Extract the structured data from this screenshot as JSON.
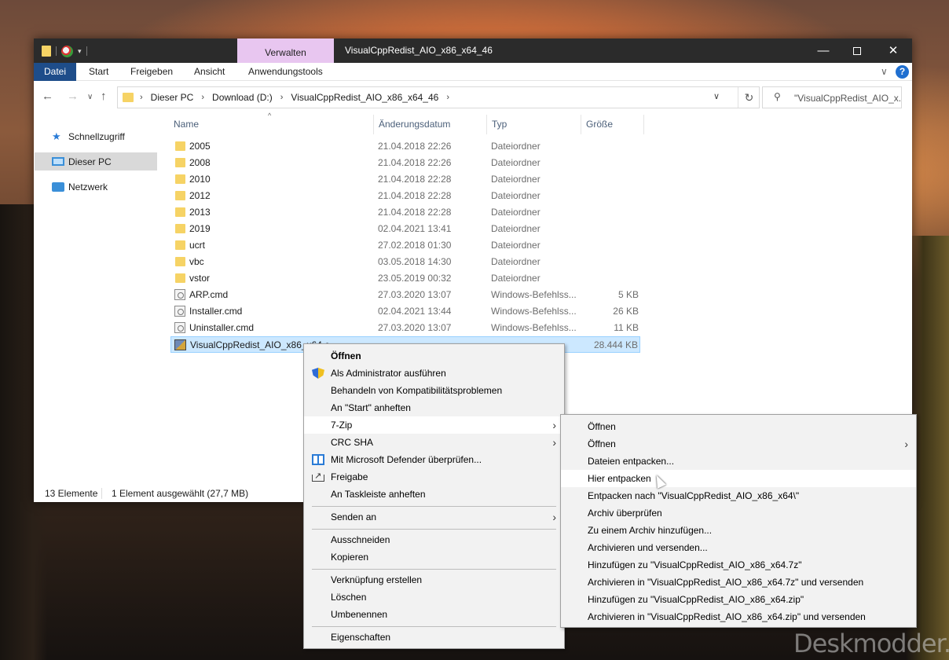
{
  "window": {
    "title": "VisualCppRedist_AIO_x86_x64_46",
    "context_tab": "Verwalten",
    "controls": {
      "minimize": "—",
      "close": "✕"
    }
  },
  "ribbon": {
    "tabs": [
      "Datei",
      "Start",
      "Freigeben",
      "Ansicht",
      "Anwendungstools"
    ],
    "expand": "∨",
    "help": "?"
  },
  "nav": {
    "back": "←",
    "forward": "→",
    "recent": "∨",
    "up": "↑",
    "crumbs": [
      "Dieser PC",
      "Download (D:)",
      "VisualCppRedist_AIO_x86_x64_46"
    ],
    "crumb_sep": "›",
    "refresh": "↻",
    "search_placeholder": "\"VisualCppRedist_AIO_x..."
  },
  "sidebar": {
    "items": [
      "Schnellzugriff",
      "Dieser PC",
      "Netzwerk"
    ]
  },
  "columns": {
    "name": "Name",
    "date": "Änderungsdatum",
    "type": "Typ",
    "size": "Größe"
  },
  "files": [
    {
      "name": "2005",
      "date": "21.04.2018 22:26",
      "type": "Dateiordner",
      "size": "",
      "icon": "folder-icon"
    },
    {
      "name": "2008",
      "date": "21.04.2018 22:26",
      "type": "Dateiordner",
      "size": "",
      "icon": "folder-icon"
    },
    {
      "name": "2010",
      "date": "21.04.2018 22:28",
      "type": "Dateiordner",
      "size": "",
      "icon": "folder-icon"
    },
    {
      "name": "2012",
      "date": "21.04.2018 22:28",
      "type": "Dateiordner",
      "size": "",
      "icon": "folder-icon"
    },
    {
      "name": "2013",
      "date": "21.04.2018 22:28",
      "type": "Dateiordner",
      "size": "",
      "icon": "folder-icon"
    },
    {
      "name": "2019",
      "date": "02.04.2021 13:41",
      "type": "Dateiordner",
      "size": "",
      "icon": "folder-icon"
    },
    {
      "name": "ucrt",
      "date": "27.02.2018 01:30",
      "type": "Dateiordner",
      "size": "",
      "icon": "folder-icon"
    },
    {
      "name": "vbc",
      "date": "03.05.2018 14:30",
      "type": "Dateiordner",
      "size": "",
      "icon": "folder-icon"
    },
    {
      "name": "vstor",
      "date": "23.05.2019 00:32",
      "type": "Dateiordner",
      "size": "",
      "icon": "folder-icon"
    },
    {
      "name": "ARP.cmd",
      "date": "27.03.2020 13:07",
      "type": "Windows-Befehlss...",
      "size": "5 KB",
      "icon": "cmd-file-icon"
    },
    {
      "name": "Installer.cmd",
      "date": "02.04.2021 13:44",
      "type": "Windows-Befehlss...",
      "size": "26 KB",
      "icon": "cmd-file-icon"
    },
    {
      "name": "Uninstaller.cmd",
      "date": "27.03.2020 13:07",
      "type": "Windows-Befehlss...",
      "size": "11 KB",
      "icon": "cmd-file-icon"
    },
    {
      "name": "VisualCppRedist_AIO_x86_x64.exe",
      "date": "",
      "type": "",
      "size": "28.444 KB",
      "icon": "exe-file-icon"
    }
  ],
  "status": {
    "count": "13 Elemente",
    "selection": "1 Element ausgewählt (27,7 MB)"
  },
  "context_menu": {
    "items": [
      "Öffnen",
      "Als Administrator ausführen",
      "Behandeln von Kompatibilitätsproblemen",
      "An \"Start\" anheften",
      "7-Zip",
      "CRC SHA",
      "Mit Microsoft Defender überprüfen...",
      "Freigabe",
      "An Taskleiste anheften",
      "Senden an",
      "Ausschneiden",
      "Kopieren",
      "Verknüpfung erstellen",
      "Löschen",
      "Umbenennen",
      "Eigenschaften"
    ],
    "arrow": "›"
  },
  "submenu_7zip": {
    "items": [
      "Öffnen",
      "Öffnen",
      "Dateien entpacken...",
      "Hier entpacken",
      "Entpacken nach \"VisualCppRedist_AIO_x86_x64\\\"",
      "Archiv überprüfen",
      "Zu einem Archiv hinzufügen...",
      "Archivieren und versenden...",
      "Hinzufügen zu \"VisualCppRedist_AIO_x86_x64.7z\"",
      "Archivieren in \"VisualCppRedist_AIO_x86_x64.7z\" und versenden",
      "Hinzufügen zu \"VisualCppRedist_AIO_x86_x64.zip\"",
      "Archivieren in \"VisualCppRedist_AIO_x86_x64.zip\" und versenden"
    ],
    "arrow": "›"
  },
  "watermark": "Deskmodder.de"
}
